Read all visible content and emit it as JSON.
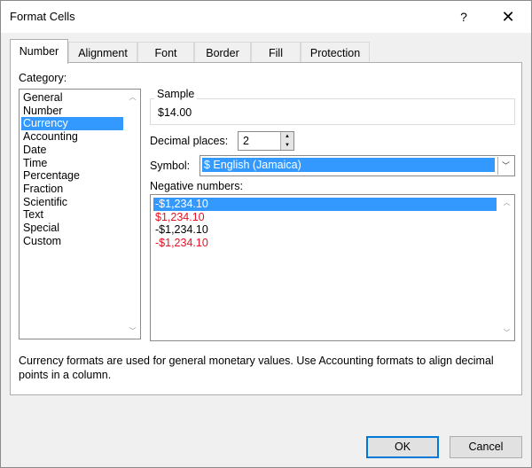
{
  "window": {
    "title": "Format Cells",
    "help_label": "?",
    "close_label": "✕"
  },
  "tabs": [
    {
      "label": "Number",
      "active": true
    },
    {
      "label": "Alignment",
      "active": false
    },
    {
      "label": "Font",
      "active": false
    },
    {
      "label": "Border",
      "active": false
    },
    {
      "label": "Fill",
      "active": false
    },
    {
      "label": "Protection",
      "active": false
    }
  ],
  "category": {
    "label": "Category:",
    "items": [
      "General",
      "Number",
      "Currency",
      "Accounting",
      "Date",
      "Time",
      "Percentage",
      "Fraction",
      "Scientific",
      "Text",
      "Special",
      "Custom"
    ],
    "selected": "Currency"
  },
  "sample": {
    "label": "Sample",
    "value": "$14.00"
  },
  "decimal_places": {
    "label": "Decimal places:",
    "value": "2"
  },
  "symbol": {
    "label": "Symbol:",
    "value": "$ English (Jamaica)"
  },
  "negative_numbers": {
    "label": "Negative numbers:",
    "items": [
      {
        "text": "-$1,234.10",
        "color": "#000000",
        "selected": true
      },
      {
        "text": "$1,234.10",
        "color": "#e81123",
        "selected": false
      },
      {
        "text": "-$1,234.10",
        "color": "#000000",
        "selected": false
      },
      {
        "text": "-$1,234.10",
        "color": "#e81123",
        "selected": false
      }
    ]
  },
  "description": "Currency formats are used for general monetary values.  Use Accounting formats to align decimal points in a column.",
  "buttons": {
    "ok": "OK",
    "cancel": "Cancel"
  },
  "colors": {
    "accent": "#0078d7",
    "selection": "#3399ff",
    "negative_red": "#e81123"
  },
  "icons": {
    "spin_up": "▲",
    "spin_down": "▼",
    "dropdown": "﹀",
    "scroll_up": "︿",
    "scroll_down": "﹀"
  }
}
